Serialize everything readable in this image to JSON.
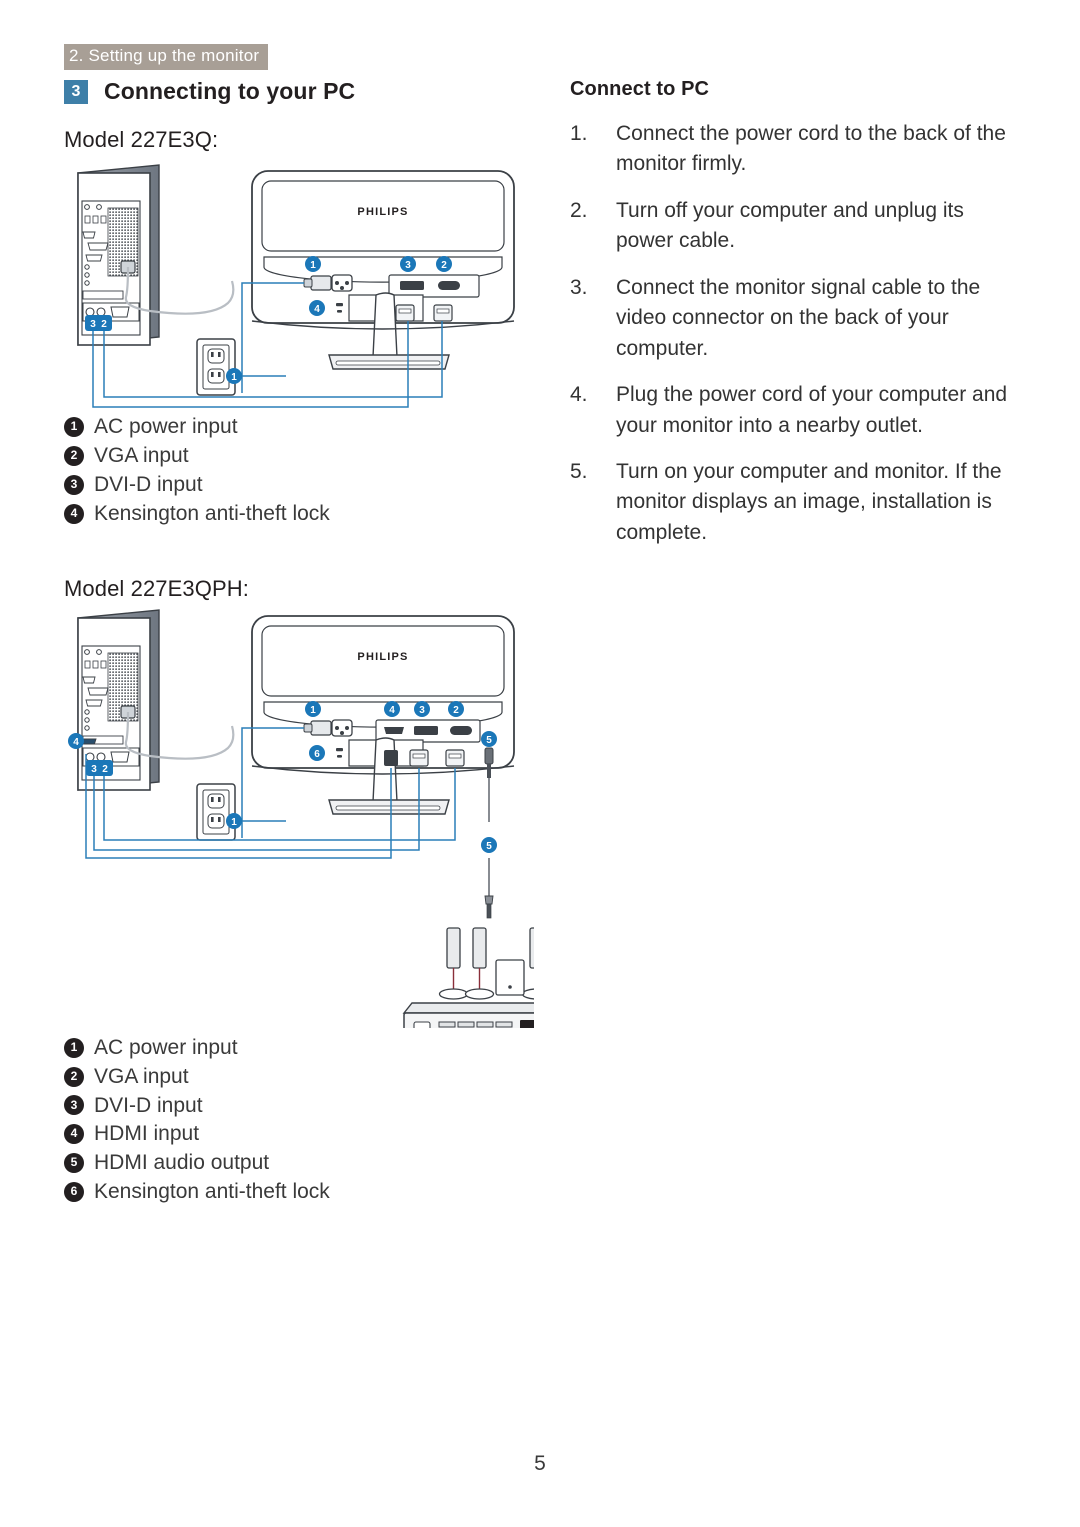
{
  "header": {
    "section_tab": "2. Setting up the monitor"
  },
  "left": {
    "section_number": "3",
    "section_title": "Connecting to your PC",
    "model_1_heading": "Model 227E3Q:",
    "model_2_heading": "Model 227E3QPH:",
    "brand_logo": "PHILIPS",
    "legend_1": [
      {
        "n": "1",
        "label": "AC power input"
      },
      {
        "n": "2",
        "label": "VGA input"
      },
      {
        "n": "3",
        "label": "DVI-D input"
      },
      {
        "n": "4",
        "label": "Kensington anti-theft lock"
      }
    ],
    "legend_2": [
      {
        "n": "1",
        "label": "AC power input"
      },
      {
        "n": "2",
        "label": "VGA input"
      },
      {
        "n": "3",
        "label": "DVI-D input"
      },
      {
        "n": "4",
        "label": "HDMI input"
      },
      {
        "n": "5",
        "label": "HDMI audio output"
      },
      {
        "n": "6",
        "label": "Kensington anti-theft lock"
      }
    ],
    "figure_1_callouts": [
      "1",
      "2",
      "3",
      "4"
    ],
    "figure_2_callouts": [
      "1",
      "2",
      "3",
      "4",
      "5",
      "6"
    ]
  },
  "right": {
    "title": "Connect to PC",
    "steps": [
      {
        "n": "1.",
        "text": "Connect the power cord to the back of the monitor firmly."
      },
      {
        "n": "2.",
        "text": "Turn off your computer and unplug its power cable."
      },
      {
        "n": "3.",
        "text": "Connect the monitor signal cable to the video connector on the back of your computer."
      },
      {
        "n": "4.",
        "text": "Plug the power cord of your computer and your monitor into a nearby outlet."
      },
      {
        "n": "5.",
        "text": "Turn on your computer and monitor. If the monitor displays an image,  installation is complete."
      }
    ]
  },
  "footer": {
    "page_number": "5"
  },
  "colors": {
    "tab_background": "#a89f96",
    "badge_blue": "#3e7fa8",
    "callout_blue": "#1b77b8",
    "legend_dot": "#231f20",
    "text": "#333333"
  }
}
